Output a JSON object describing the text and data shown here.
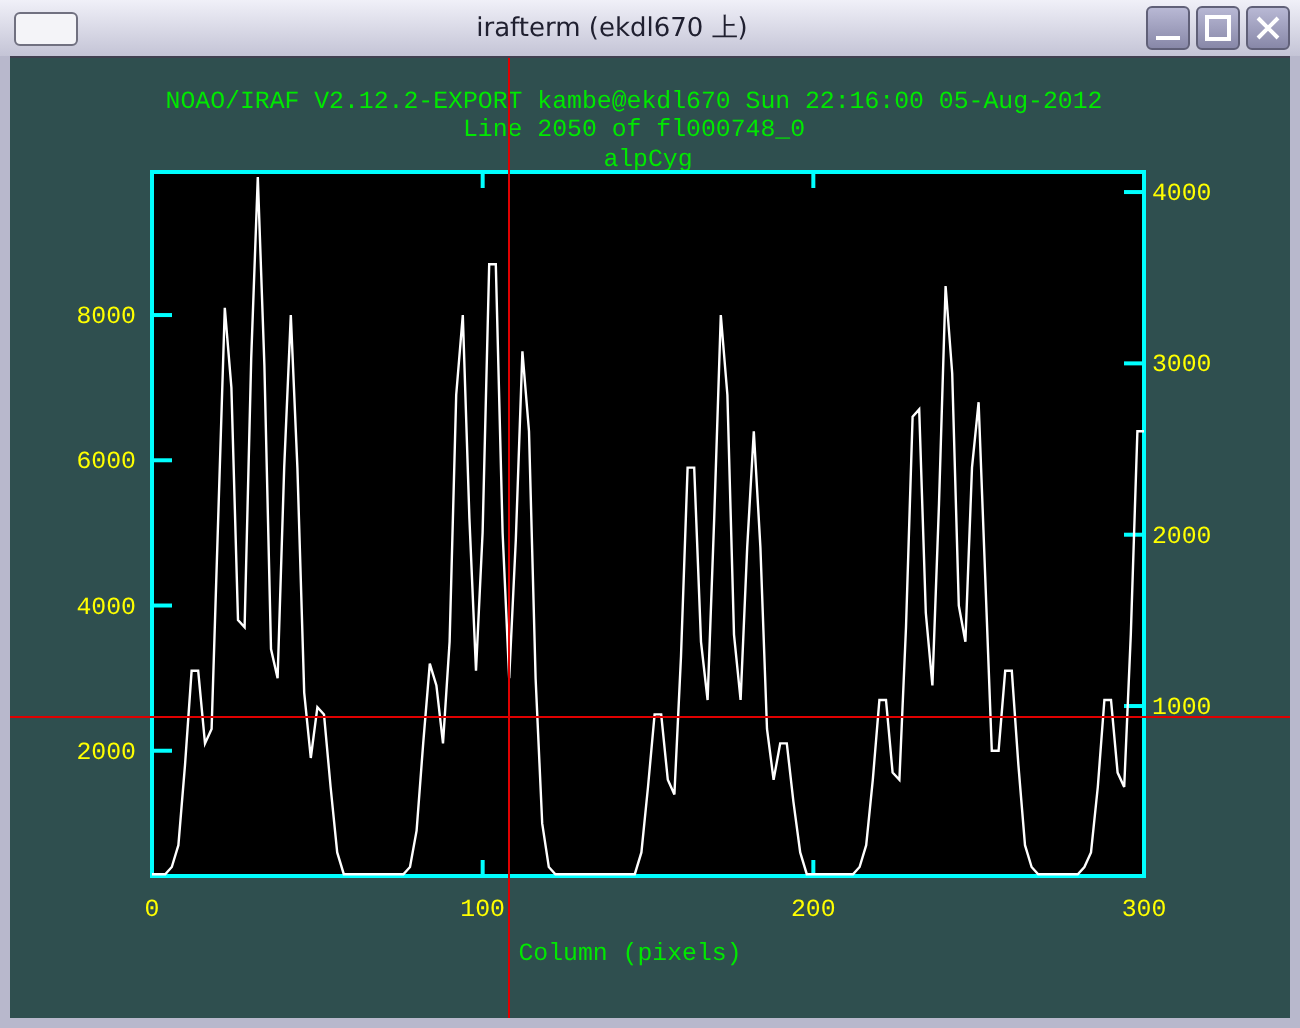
{
  "window": {
    "title": "irafterm (ekdl670 上)"
  },
  "plot": {
    "header": [
      "NOAO/IRAF V2.12.2-EXPORT kambe@ekdl670 Sun 22:16:00 05-Aug-2012",
      "Line 2050 of fl000748_0"
    ],
    "chart_data": {
      "type": "line",
      "title": "alpCyg",
      "xlabel": "Column (pixels)",
      "x": [
        0,
        2,
        4,
        6,
        8,
        10,
        12,
        14,
        16,
        18,
        20,
        22,
        24,
        26,
        28,
        30,
        32,
        34,
        36,
        38,
        40,
        42,
        44,
        46,
        48,
        50,
        52,
        54,
        56,
        58,
        60,
        62,
        64,
        66,
        68,
        70,
        72,
        74,
        76,
        78,
        80,
        82,
        84,
        86,
        88,
        90,
        92,
        94,
        96,
        98,
        100,
        102,
        104,
        106,
        108,
        110,
        112,
        114,
        116,
        118,
        120,
        122,
        124,
        126,
        128,
        130,
        132,
        134,
        136,
        138,
        140,
        142,
        144,
        146,
        148,
        150,
        152,
        154,
        156,
        158,
        160,
        162,
        164,
        166,
        168,
        170,
        172,
        174,
        176,
        178,
        180,
        182,
        184,
        186,
        188,
        190,
        192,
        194,
        196,
        198,
        200,
        202,
        204,
        206,
        208,
        210,
        212,
        214,
        216,
        218,
        220,
        222,
        224,
        226,
        228,
        230,
        232,
        234,
        236,
        238,
        240,
        242,
        244,
        246,
        248,
        250,
        252,
        254,
        256,
        258,
        260,
        262,
        264,
        266,
        268,
        270,
        272,
        274,
        276,
        278,
        280,
        282,
        284,
        286,
        288,
        290,
        292,
        294,
        296,
        298,
        300
      ],
      "series": [
        {
          "color": "#ffffff",
          "values": [
            300,
            300,
            300,
            400,
            700,
            1800,
            3100,
            3100,
            2100,
            2300,
            5200,
            8100,
            7000,
            3800,
            3700,
            7400,
            9900,
            7300,
            3400,
            3000,
            5900,
            8000,
            5900,
            2800,
            1900,
            2600,
            2500,
            1500,
            600,
            300,
            300,
            300,
            300,
            300,
            300,
            300,
            300,
            300,
            300,
            400,
            900,
            2100,
            3200,
            2900,
            2100,
            3500,
            6900,
            8000,
            5200,
            3100,
            5000,
            8700,
            8700,
            5000,
            3000,
            4900,
            7500,
            6400,
            3000,
            1000,
            400,
            300,
            300,
            300,
            300,
            300,
            300,
            300,
            300,
            300,
            300,
            300,
            300,
            300,
            600,
            1500,
            2500,
            2500,
            1600,
            1400,
            3300,
            5900,
            5900,
            3500,
            2700,
            5200,
            8000,
            6900,
            3600,
            2700,
            4800,
            6400,
            4800,
            2300,
            1600,
            2100,
            2100,
            1300,
            600,
            300,
            300,
            300,
            300,
            300,
            300,
            300,
            300,
            400,
            700,
            1600,
            2700,
            2700,
            1700,
            1600,
            3700,
            6600,
            6700,
            3900,
            2900,
            5400,
            8400,
            7200,
            4000,
            3500,
            5900,
            6800,
            4400,
            2000,
            2000,
            3100,
            3100,
            1800,
            700,
            400,
            300,
            300,
            300,
            300,
            300,
            300,
            300,
            400,
            600,
            1500,
            2700,
            2700,
            1700,
            1500,
            3600,
            6400,
            6400
          ]
        }
      ],
      "xlim": [
        0,
        300
      ],
      "ylim": [
        275,
        9970
      ],
      "xticks": [
        0,
        100,
        200,
        300
      ],
      "yticks": [
        2000,
        4000,
        6000,
        8000
      ],
      "y2lim": [
        8,
        4117
      ],
      "y2ticks": [
        1000,
        2000,
        3000,
        4000
      ],
      "ref_lines": [
        {
          "axis": "x",
          "value": 107.5,
          "color": "#e00000"
        },
        {
          "axis": "y",
          "value": 2480,
          "color": "#e00000"
        }
      ]
    }
  }
}
